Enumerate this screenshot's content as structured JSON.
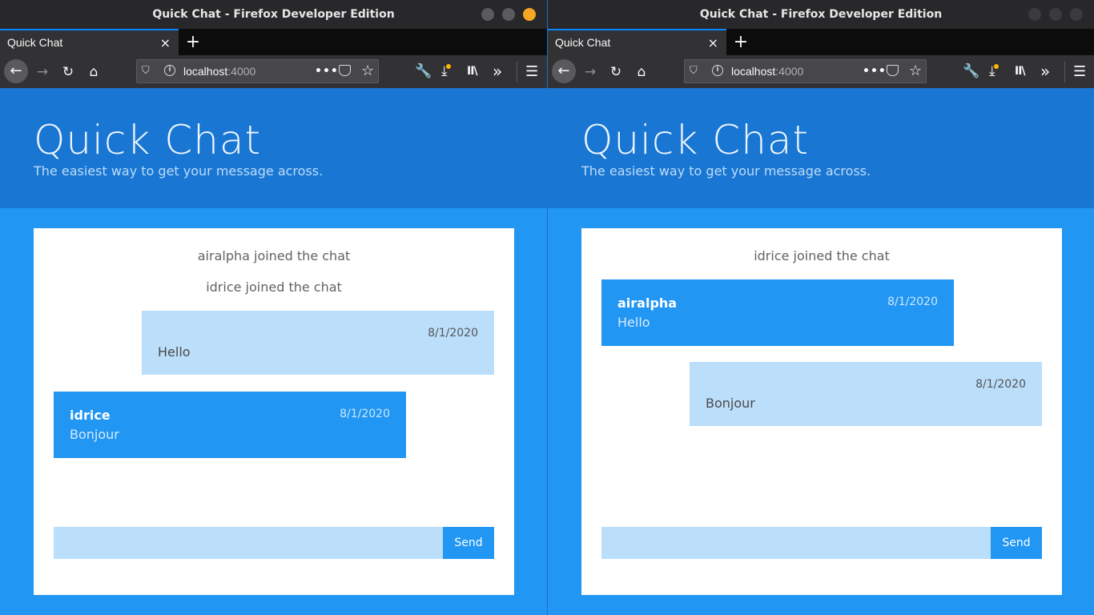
{
  "windows": [
    {
      "window_title": "Quick Chat - Firefox Developer Edition",
      "tab_title": "Quick Chat",
      "url_host": "localhost",
      "url_port": ":4000",
      "hero_title": "Quick Chat",
      "hero_subtitle": "The easiest way to get your message across.",
      "system_1": "airalpha joined the chat",
      "system_2": "idrice joined the chat",
      "msg_mine_date": "8/1/2020",
      "msg_mine_text": "Hello",
      "msg_other_user": "idrice",
      "msg_other_date": "8/1/2020",
      "msg_other_text": "Bonjour",
      "message_input_value": "",
      "send_label": "Send"
    },
    {
      "window_title": "Quick Chat - Firefox Developer Edition",
      "tab_title": "Quick Chat",
      "url_host": "localhost",
      "url_port": ":4000",
      "hero_title": "Quick Chat",
      "hero_subtitle": "The easiest way to get your message across.",
      "system_1": "idrice joined the chat",
      "msg_other_user": "airalpha",
      "msg_other_date": "8/1/2020",
      "msg_other_text": "Hello",
      "msg_mine_date": "8/1/2020",
      "msg_mine_text": "Bonjour",
      "message_input_value": "",
      "send_label": "Send"
    }
  ],
  "icons": {
    "close_tab": "×",
    "new_tab": "+",
    "back": "←",
    "forward": "→",
    "reload": "↻",
    "home": "⌂",
    "shield": "⛉",
    "info": "i",
    "more": "•••",
    "star": "☆",
    "wrench": "🔧",
    "download": "⤓",
    "library": "II\\",
    "overflow": "»",
    "menu": "☰"
  },
  "colors": {
    "header_blue": "#1976d2",
    "page_blue": "#2196f3",
    "light_bubble": "#bbdefb",
    "accent_dot": "#f5a623"
  }
}
